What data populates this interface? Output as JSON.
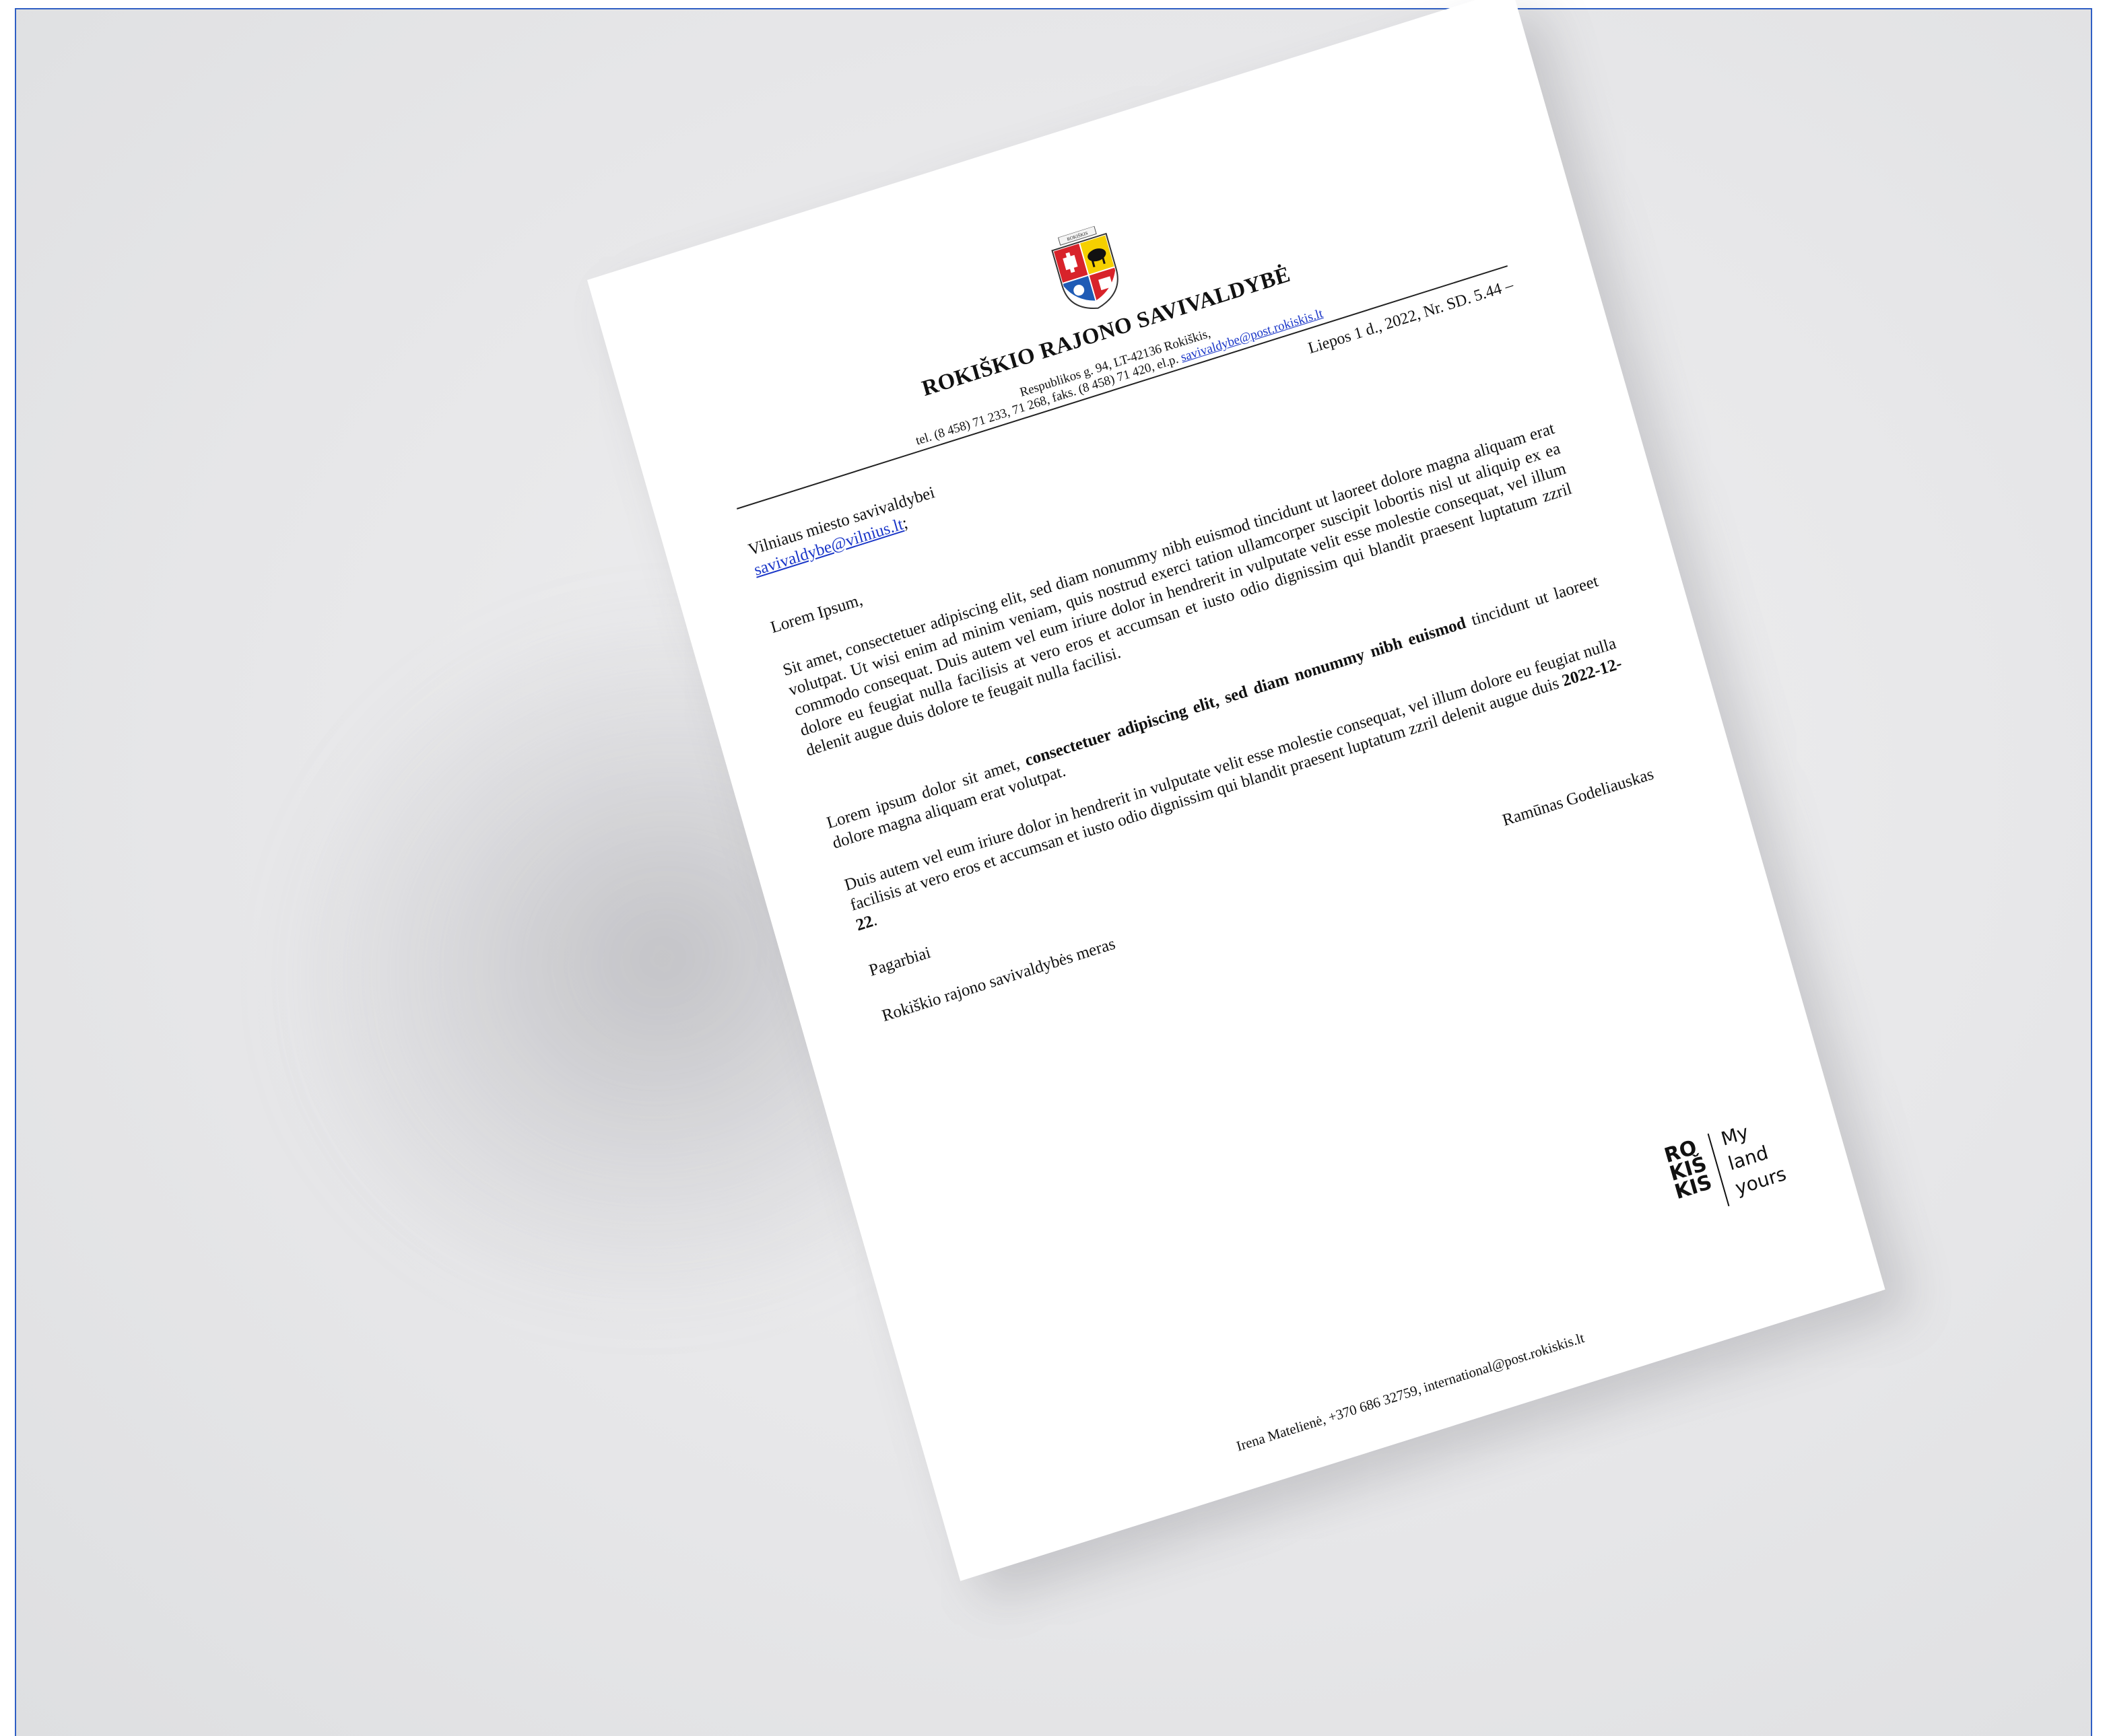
{
  "letterhead": {
    "crest_caption": "ROKIŠKIS",
    "organization": "ROKIŠKIO RAJONO SAVIVALDYBĖ",
    "address": "Respublikos g. 94, LT-42136 Rokiškis,",
    "contacts_prefix": "tel. (8 458) 71 233, 71 268, faks. (8 458) 71 420, el.p. ",
    "contacts_email": "savivaldybe@post.rokiskis.lt"
  },
  "date_line": "Liepos 1 d., 2022, Nr. SD. 5.44 –",
  "recipient": {
    "name": "Vilniaus miesto savivaldybei",
    "email": "savivaldybe@vilnius.lt",
    "email_suffix": ";"
  },
  "salutation": "Lorem Ipsum,",
  "paragraph1": "Sit amet, consectetuer adipiscing elit, sed diam nonummy nibh euismod tincidunt ut laoreet dolore magna aliquam erat volutpat. Ut wisi enim ad minim veniam, quis nostrud exerci tation ullamcorper suscipit lobortis nisl ut aliquip ex ea commodo consequat. Duis autem vel eum iriure dolor in hendrerit in vulputate velit esse molestie consequat, vel illum dolore eu feugiat nulla facilisis at vero eros et accumsan et iusto odio dignissim qui blandit praesent luptatum zzril delenit augue duis dolore te feugait nulla facilisi.",
  "paragraph2": {
    "before": "Lorem ipsum dolor sit amet, ",
    "bold": "consectetuer adipiscing elit, sed diam nonummy nibh euismod",
    "after": " tincidunt ut laoreet dolore magna aliquam erat volutpat."
  },
  "paragraph3": {
    "before": "Duis autem vel eum iriure dolor in hendrerit in vulputate velit esse molestie consequat, vel illum dolore eu feugiat nulla facilisis at vero eros et accumsan et iusto odio dignissim qui blandit praesent luptatum zzril delenit augue duis ",
    "bold": "2022-12-22",
    "after": "."
  },
  "closing": "Pagarbiai",
  "signer_title": "Rokiškio rajono savivaldybės meras",
  "signer_name": "Ramūnas Godeliauskas",
  "brand": {
    "word_lines": [
      "ROKIŠKIS"
    ],
    "tagline": [
      "My",
      "land",
      "yours"
    ]
  },
  "footer": "Irena Matelienė, +370 686 32759, international@post.rokiskis.lt",
  "colors": {
    "link": "#1a36c8",
    "frame_border": "#2f5fc4",
    "background": "#e7e7e9"
  }
}
